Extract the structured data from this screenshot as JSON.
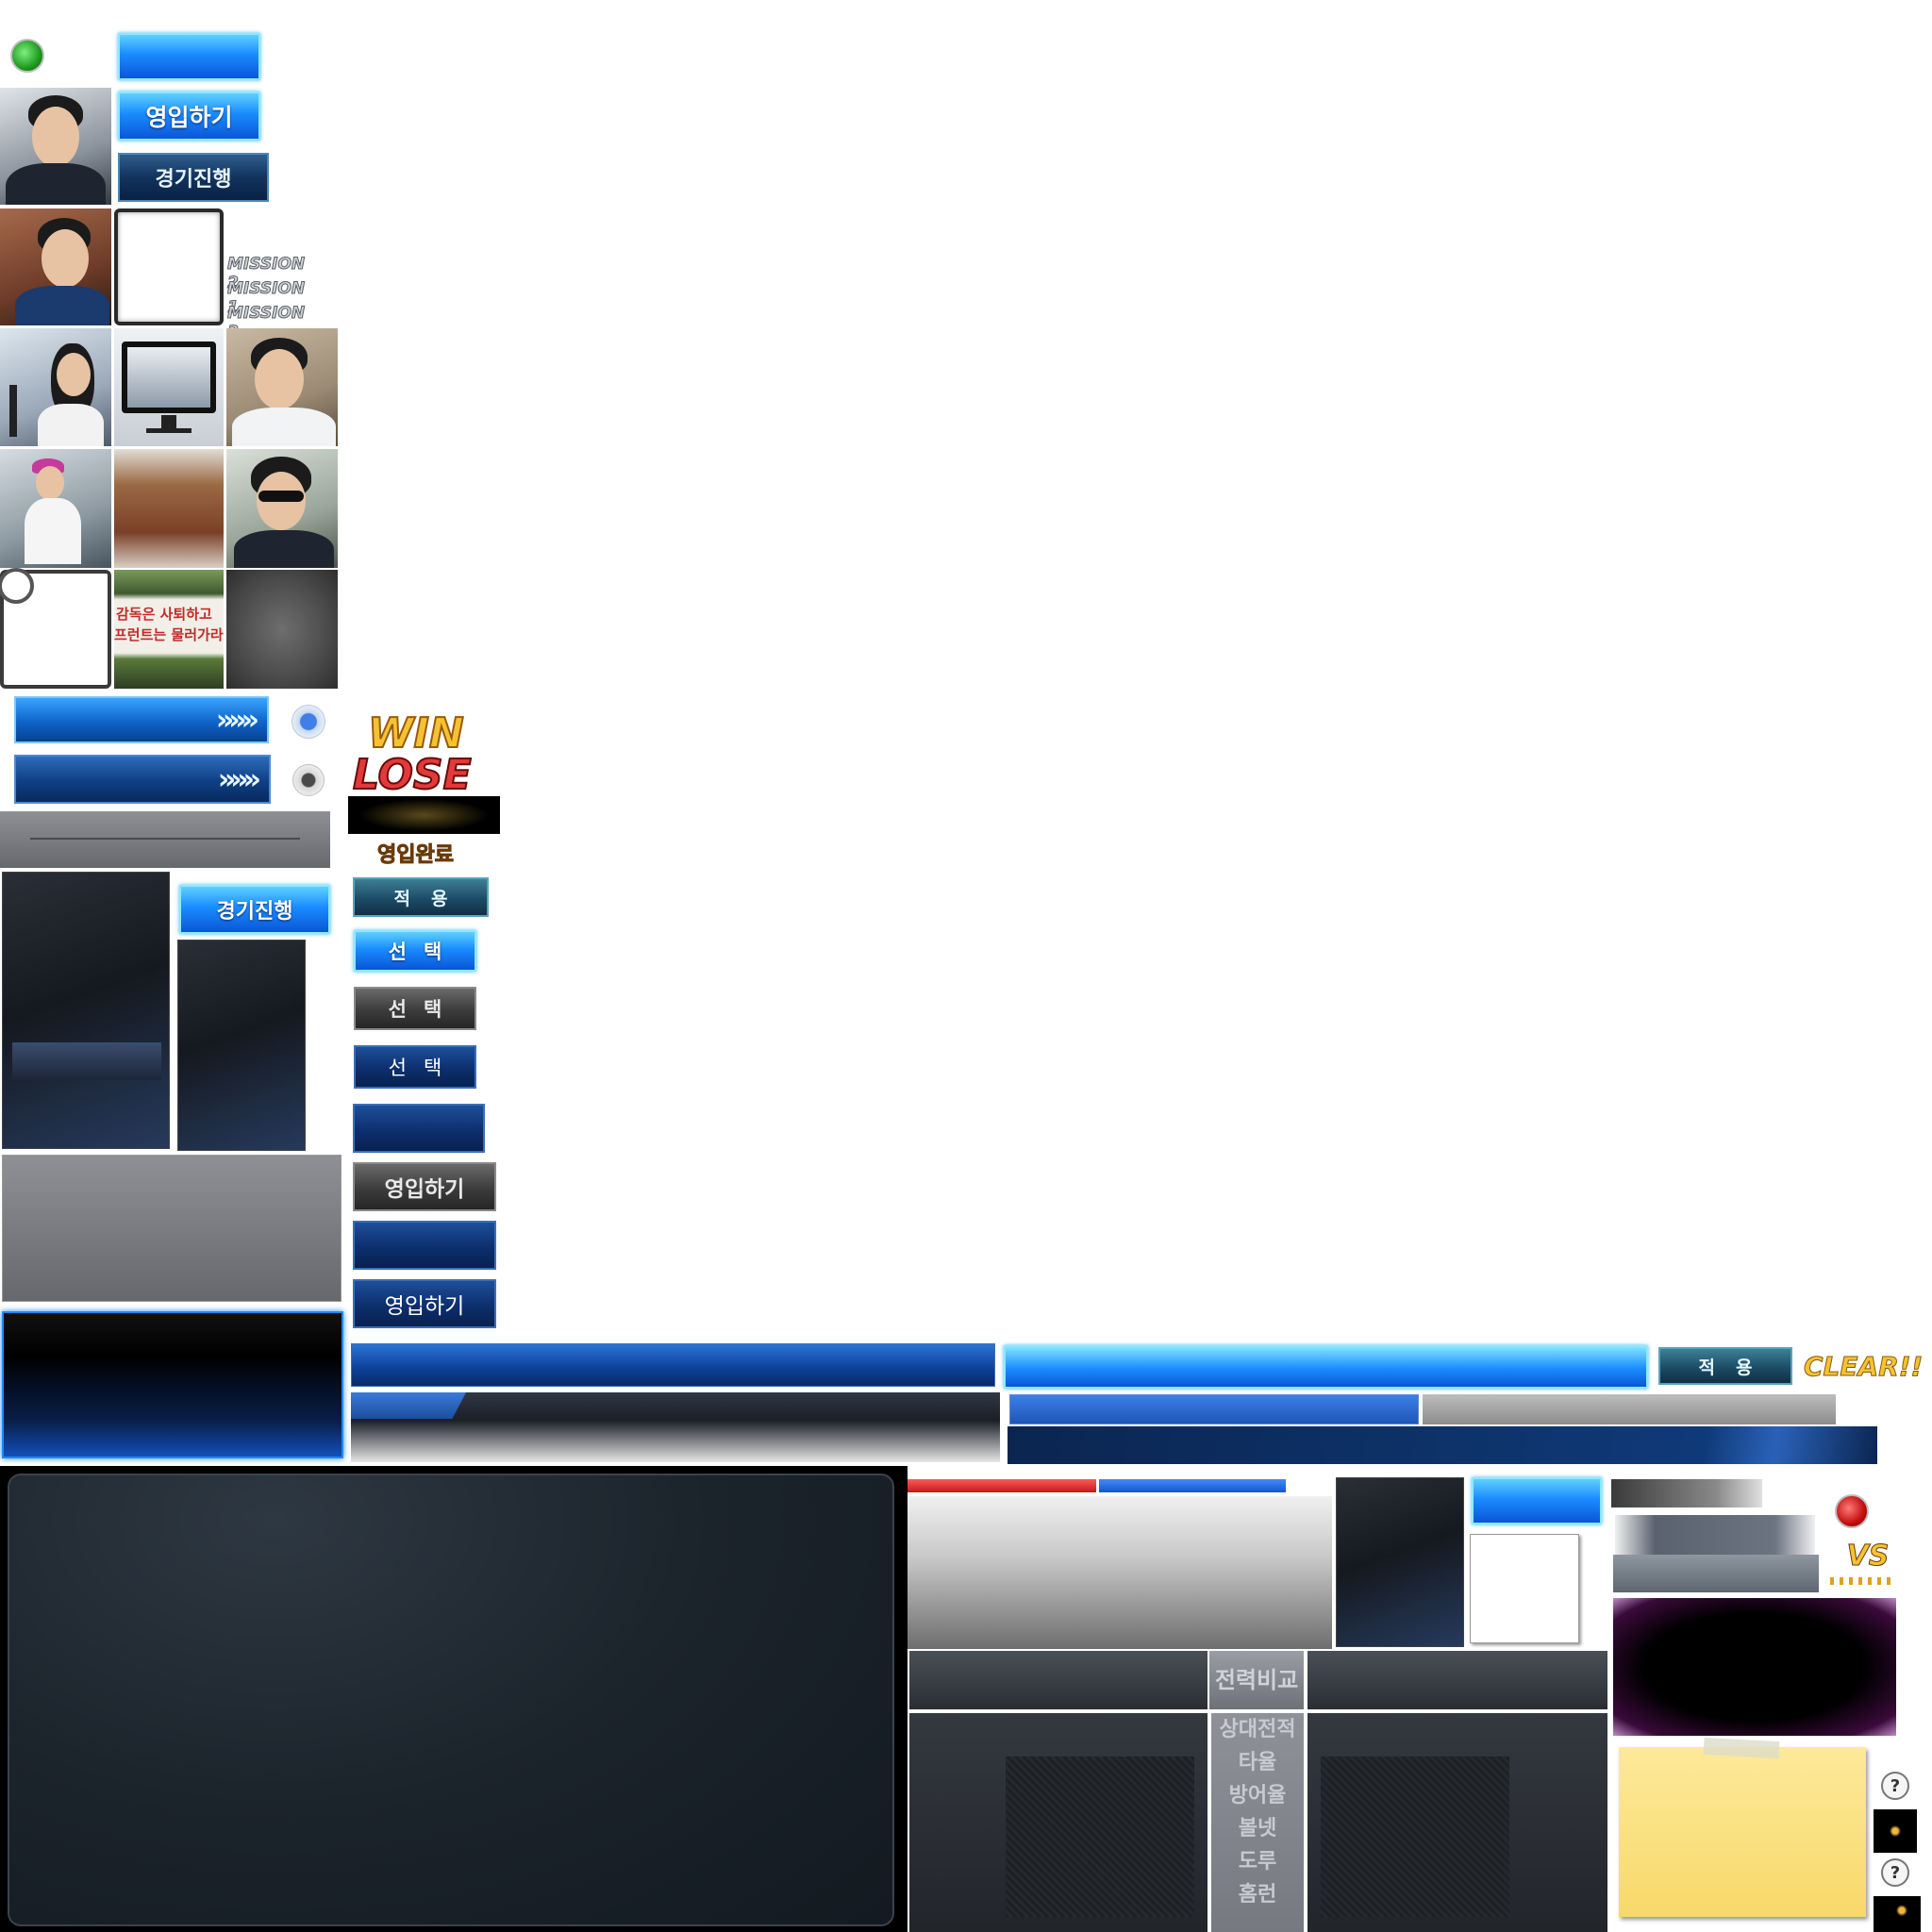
{
  "buttons": {
    "scout_bright": "영입하기",
    "match_proceed_dark": "경기진행",
    "match_proceed_bright": "경기진행",
    "scout_gray": "영입하기",
    "scout_navy": "영입하기",
    "apply_teal": "적용",
    "apply_teal_small": "적용",
    "select_bright": "선택",
    "select_gray": "선택",
    "select_dark": "선택",
    "arrow_glyph": "»»»"
  },
  "labels": {
    "scout_complete": "영입완료",
    "win": "WIN",
    "lose": "LOSE",
    "clear": "CLEAR!!",
    "vs": "VS",
    "power_compare": "전력비교"
  },
  "missions": [
    "MISSION 2",
    "MISSION 1",
    "MISSION 3"
  ],
  "banner_text": [
    "감독은 사퇴하고",
    "프런트는 물러가라"
  ],
  "stats_menu": [
    "상대전적",
    "타율",
    "방어율",
    "볼넷",
    "도루",
    "홈런"
  ],
  "help_glyph": "?",
  "colors": {
    "status_green": "#2bb52b",
    "status_red": "#d61c1c",
    "accent_blue": "#1a8cff",
    "gold": "#f5c232"
  },
  "icons": {
    "green_status": "green-dot-icon",
    "red_status": "red-dot-icon",
    "radio_on": "radio-selected-icon",
    "radio_off": "radio-unselected-icon",
    "help": "help-question-icon",
    "sparkle": "sparkle-icon"
  }
}
